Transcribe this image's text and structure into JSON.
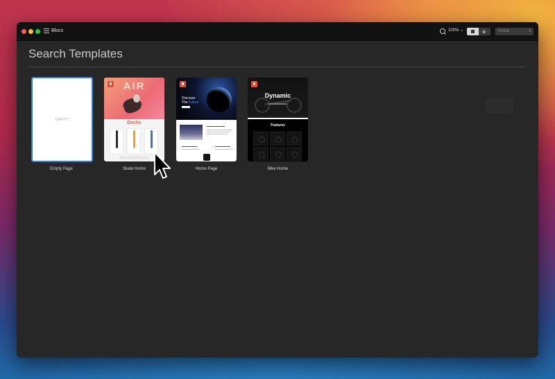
{
  "window": {
    "app_title": "Blocs",
    "zoom": "100%",
    "page_select": "Home"
  },
  "main": {
    "heading": "Search Templates",
    "empty_text": "EMPTY",
    "templates": [
      {
        "label": "Empty Page"
      },
      {
        "label": "Skate Home",
        "hero_text": "AIR",
        "section_text": "Decks"
      },
      {
        "label": "Home Page",
        "hero_line1": "Discover",
        "hero_line2": "The",
        "hero_line2_accent": "Future"
      },
      {
        "label": "Bike Home",
        "hero_text": "Dynamic",
        "section_text": "Features"
      }
    ]
  },
  "colors": {
    "selection": "#2f7fe6",
    "badge": "#e8482e",
    "window_bg": "#272727"
  },
  "icons": [
    "close-icon",
    "minimize-icon",
    "zoom-icon",
    "sidebar-menu-icon",
    "search-icon",
    "chevron-down-icon",
    "stop-icon",
    "play-icon",
    "trash-icon",
    "mouse-pointer-icon"
  ]
}
